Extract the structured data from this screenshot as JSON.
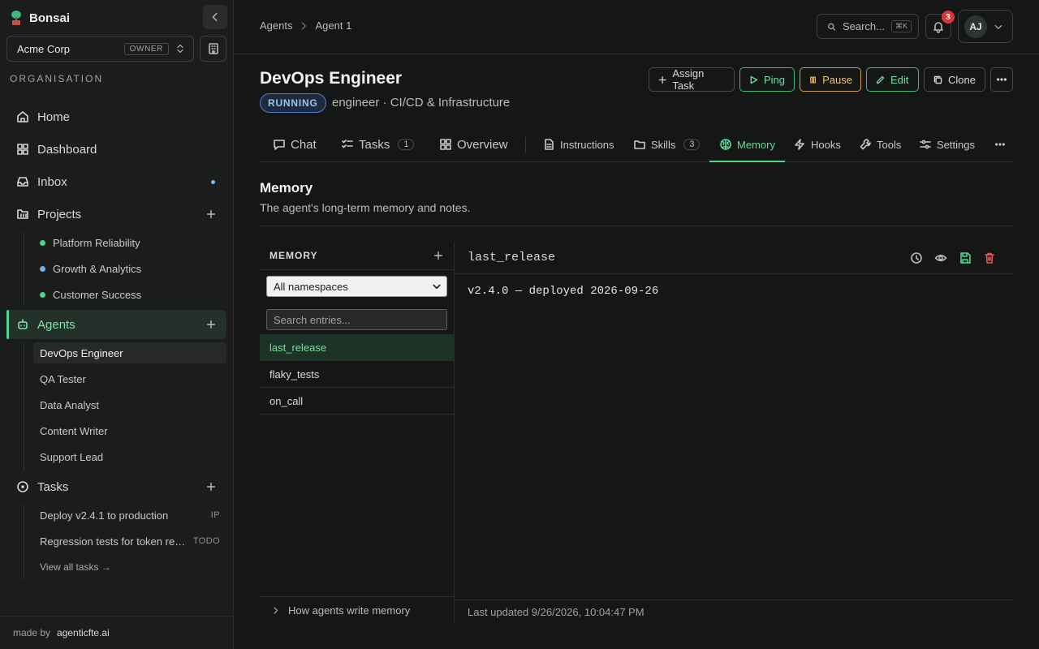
{
  "sidebar": {
    "brand": "Bonsai",
    "org": {
      "name": "Acme Corp",
      "role": "OWNER"
    },
    "section_label": "ORGANISATION",
    "nav": {
      "home": "Home",
      "dashboard": "Dashboard",
      "inbox": "Inbox",
      "projects": "Projects",
      "agents": "Agents",
      "tasks": "Tasks"
    },
    "projects": [
      {
        "name": "Platform Reliability",
        "color": "#4fd58f"
      },
      {
        "name": "Growth & Analytics",
        "color": "#6fb3e8"
      },
      {
        "name": "Customer Success",
        "color": "#4fd58f"
      }
    ],
    "agents": [
      "DevOps Engineer",
      "QA Tester",
      "Data Analyst",
      "Content Writer",
      "Support Lead"
    ],
    "tasks": [
      {
        "title": "Deploy v2.4.1 to production",
        "status": "IP"
      },
      {
        "title": "Regression tests for token refr...",
        "status": "TODO"
      }
    ],
    "view_all_tasks": "View all tasks →",
    "footer": {
      "made_by": "made by",
      "link": "agenticfte.ai"
    }
  },
  "topbar": {
    "breadcrumb": [
      "Agents",
      "Agent 1"
    ],
    "search_label": "Search...",
    "search_shortcut": "⌘K",
    "notifications_count": "3",
    "user_initials": "AJ"
  },
  "agent": {
    "name": "DevOps Engineer",
    "status": "RUNNING",
    "subtitle": "engineer · CI/CD & Infrastructure"
  },
  "actions": {
    "assign": "Assign Task",
    "ping": "Ping",
    "pause": "Pause",
    "edit": "Edit",
    "clone": "Clone"
  },
  "tabs": {
    "chat": "Chat",
    "tasks": "Tasks",
    "tasks_count": "1",
    "overview": "Overview",
    "instructions": "Instructions",
    "skills": "Skills",
    "skills_count": "3",
    "memory": "Memory",
    "hooks": "Hooks",
    "tools": "Tools",
    "settings": "Settings"
  },
  "memory": {
    "title": "Memory",
    "description": "The agent's long-term memory and notes.",
    "panel_label": "MEMORY",
    "namespace_selected": "All namespaces",
    "search_placeholder": "Search entries...",
    "entries": [
      "last_release",
      "flaky_tests",
      "on_call"
    ],
    "selected_key": "last_release",
    "selected_value": "v2.4.0 — deployed 2026-09-26",
    "help_label": "How agents write memory",
    "last_updated": "Last updated 9/26/2026, 10:04:47 PM"
  }
}
